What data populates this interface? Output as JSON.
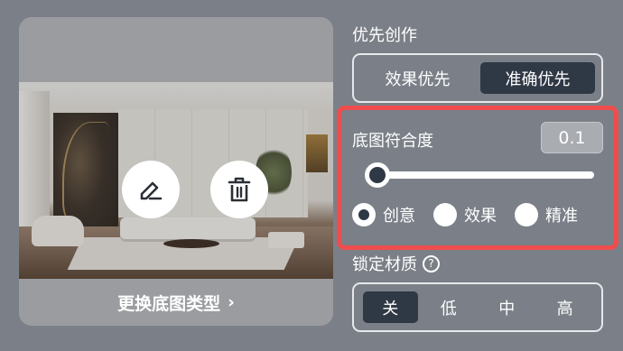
{
  "image_card": {
    "change_type_label": "更换底图类型",
    "chevron_glyph": "›",
    "icons": [
      "edit-icon",
      "trash-icon"
    ]
  },
  "creation_priority": {
    "label": "优先创作",
    "options": [
      {
        "label": "效果优先",
        "selected": false
      },
      {
        "label": "准确优先",
        "selected": true
      }
    ]
  },
  "base_image_fit": {
    "label": "底图符合度",
    "value": "0.1",
    "slider_level": 0.1,
    "modes": [
      {
        "label": "创意",
        "selected": true
      },
      {
        "label": "效果",
        "selected": false
      },
      {
        "label": "精准",
        "selected": false
      }
    ]
  },
  "lock_material": {
    "label": "锁定材质",
    "help_glyph": "?",
    "options": [
      {
        "label": "关",
        "selected": true
      },
      {
        "label": "低",
        "selected": false
      },
      {
        "label": "中",
        "selected": false
      },
      {
        "label": "高",
        "selected": false
      }
    ]
  },
  "colors": {
    "background": "#7b8088",
    "active": "#2f3845",
    "highlight": "#ef4d4d"
  }
}
